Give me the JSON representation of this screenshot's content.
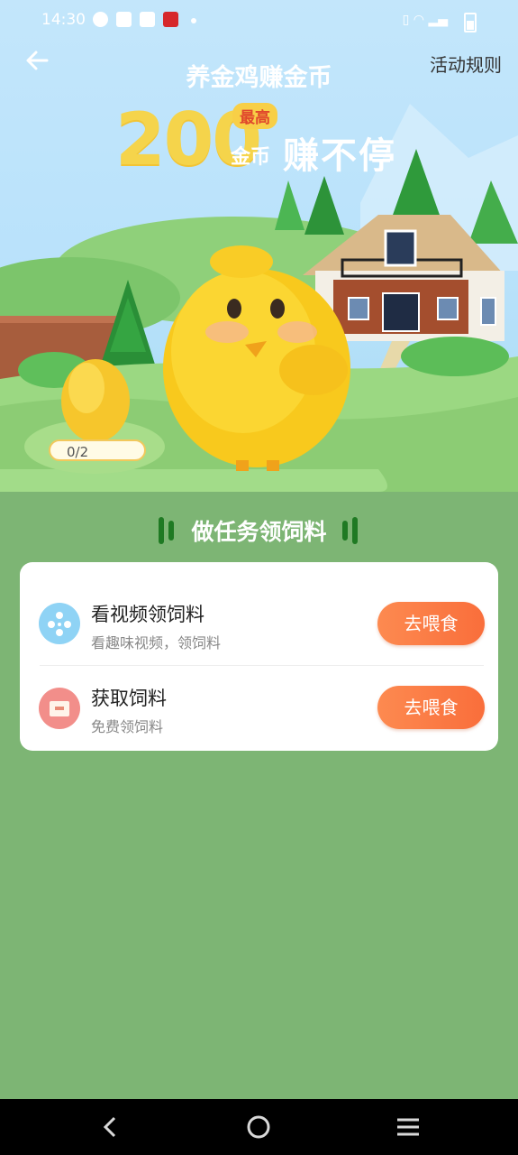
{
  "status_bar": {
    "time": "14:30"
  },
  "header": {
    "title": "养金鸡赚金币",
    "rules_label": "活动规则"
  },
  "banner": {
    "amount": "200",
    "badge": "最高",
    "unit": "金币",
    "slogan": "赚不停"
  },
  "egg": {
    "progress": "0/2"
  },
  "tasks_section": {
    "title": "做任务领饲料",
    "tasks": [
      {
        "name": "看视频领饲料",
        "desc": "看趣味视频，领饲料",
        "button": "去喂食",
        "icon": "film-reel-icon"
      },
      {
        "name": "获取饲料",
        "desc": "免费领饲料",
        "button": "去喂食",
        "icon": "feed-box-icon"
      }
    ]
  },
  "colors": {
    "accent": "#f96e3b",
    "background": "#7db574",
    "dark_green": "#1f7a23"
  }
}
